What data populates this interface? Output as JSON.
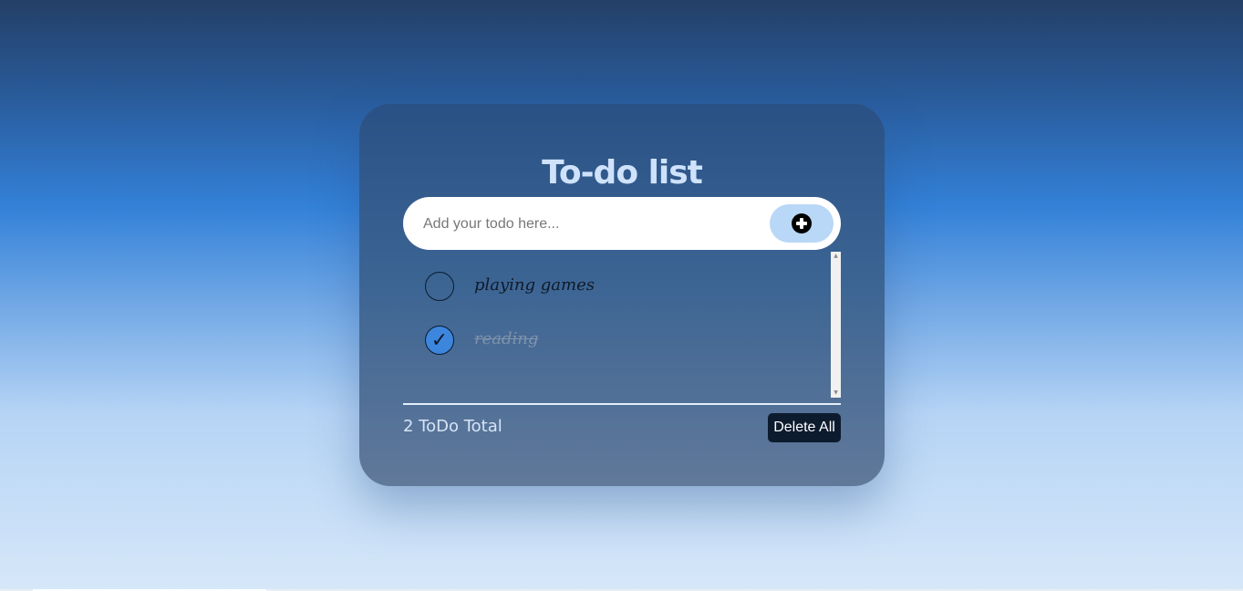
{
  "app": {
    "title": "To-do list"
  },
  "input": {
    "placeholder": "Add your todo here...",
    "value": "",
    "add_icon": "plus-circle-icon"
  },
  "todos": [
    {
      "text": "playing games",
      "completed": false
    },
    {
      "text": "reading",
      "completed": true,
      "check_glyph": "✓"
    }
  ],
  "footer": {
    "total_label": "2 ToDo Total",
    "delete_all_label": "Delete All"
  },
  "colors": {
    "accent": "#3d86dd",
    "add_button": "#b9d7f7",
    "delete_button": "#0d1b2e"
  }
}
